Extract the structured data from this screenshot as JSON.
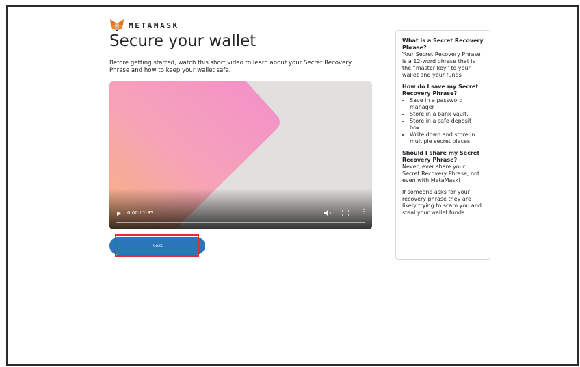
{
  "brand": {
    "name": "METAMASK"
  },
  "page": {
    "title": "Secure your wallet",
    "description": "Before getting started, watch this short video to learn about your Secret Recovery Phrase and how to keep your wallet safe."
  },
  "video": {
    "time_display": "0:00 / 1:35",
    "progress": 0,
    "play_icon": "play-icon",
    "volume_icon": "volume-icon",
    "fullscreen_icon": "fullscreen-icon",
    "more_icon": "more-options-icon"
  },
  "actions": {
    "next_label": "Next"
  },
  "info_panel": {
    "q1_title": "What is a Secret Recovery Phrase?",
    "q1_body": "Your Secret Recovery Phrase is a 12-word phrase that is the “master key” to your wallet and your funds",
    "q2_title": "How do I save my Secret Recovery Phrase?",
    "q2_items": [
      "Save in a password manager",
      "Store in a bank vault.",
      "Store in a safe-deposit box.",
      "Write down and store in multiple secret places."
    ],
    "q3_title": "Should I share my Secret Recovery Phrase?",
    "q3_body": "Never, ever share your Secret Recovery Phrase, not even with MetaMask!",
    "q3_warning": "If someone asks for your recovery phrase they are likely trying to scam you and steal your wallet funds"
  },
  "colors": {
    "primary_button": "#2a76b8",
    "highlight_box": "#e02d2d",
    "text": "#24272a"
  }
}
